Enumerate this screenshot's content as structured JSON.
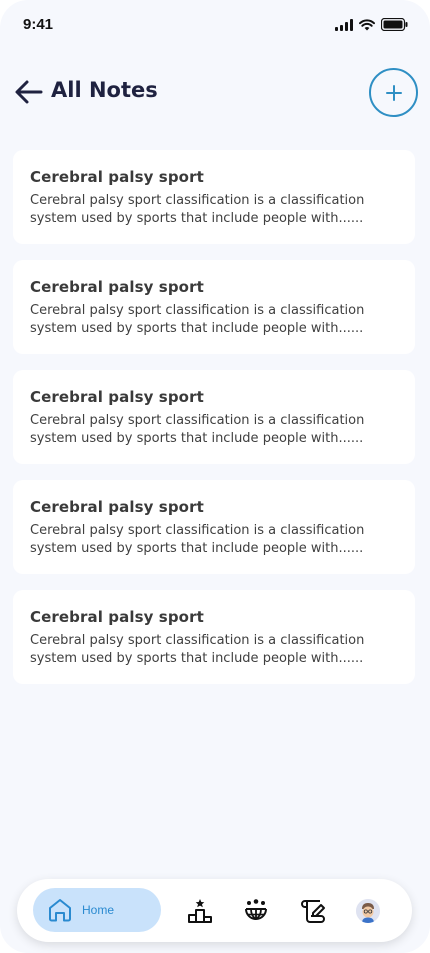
{
  "status_bar": {
    "time": "9:41"
  },
  "header": {
    "title": "All Notes"
  },
  "notes": [
    {
      "title": "Cerebral palsy sport",
      "line1": "Cerebral palsy sport classification is a classification",
      "line2": "system used by sports that include people with......"
    },
    {
      "title": "Cerebral palsy sport",
      "line1": "Cerebral palsy sport classification is a classification",
      "line2": "system used by sports that include people with......"
    },
    {
      "title": "Cerebral palsy sport",
      "line1": "Cerebral palsy sport classification is a classification",
      "line2": "system used by sports that include people with......"
    },
    {
      "title": "Cerebral palsy sport",
      "line1": "Cerebral palsy sport classification is a classification",
      "line2": "system used by sports that include people with......"
    },
    {
      "title": "Cerebral palsy sport",
      "line1": "Cerebral palsy sport classification is a classification",
      "line2": "system used by sports that include people with......"
    }
  ],
  "bottom_nav": {
    "home_label": "Home",
    "items": [
      "home-icon",
      "podium-icon",
      "community-globe-icon",
      "script-edit-icon",
      "avatar"
    ]
  },
  "colors": {
    "accent": "#2f8fc4",
    "home_pill": "#c9e2fb",
    "background": "#f6f8fd",
    "title": "#1f2240"
  }
}
